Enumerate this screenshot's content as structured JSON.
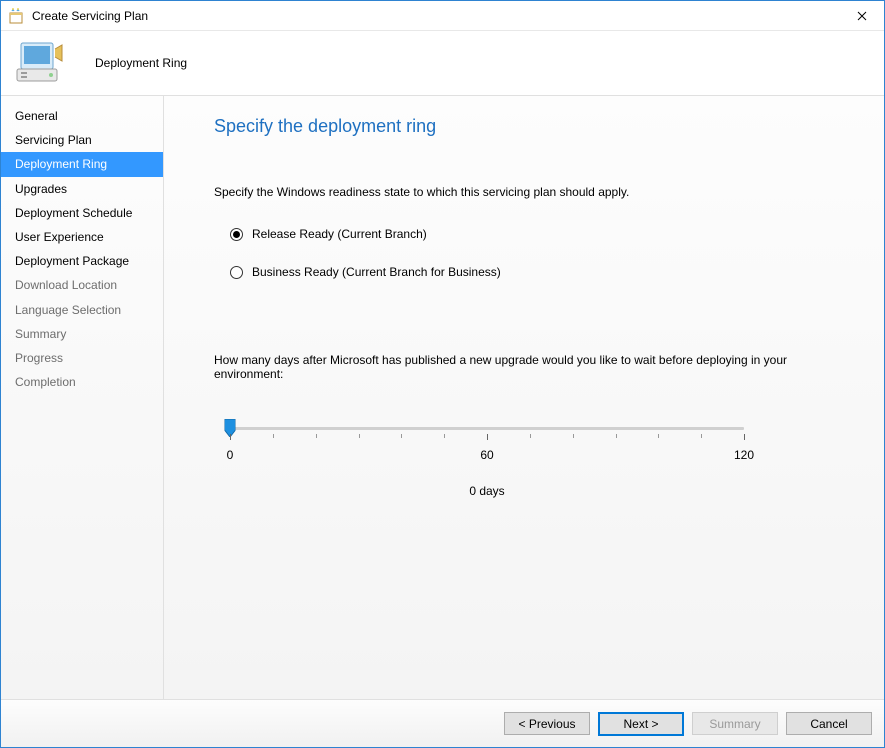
{
  "window": {
    "title": "Create Servicing Plan"
  },
  "header": {
    "subtitle": "Deployment Ring"
  },
  "sidebar": {
    "items": [
      {
        "label": "General",
        "state": "enabled"
      },
      {
        "label": "Servicing Plan",
        "state": "enabled"
      },
      {
        "label": "Deployment Ring",
        "state": "active"
      },
      {
        "label": "Upgrades",
        "state": "enabled"
      },
      {
        "label": "Deployment Schedule",
        "state": "enabled"
      },
      {
        "label": "User Experience",
        "state": "enabled"
      },
      {
        "label": "Deployment Package",
        "state": "enabled"
      },
      {
        "label": "Download Location",
        "state": "disabled"
      },
      {
        "label": "Language Selection",
        "state": "disabled"
      },
      {
        "label": "Summary",
        "state": "disabled"
      },
      {
        "label": "Progress",
        "state": "disabled"
      },
      {
        "label": "Completion",
        "state": "disabled"
      }
    ]
  },
  "main": {
    "title": "Specify the deployment ring",
    "instruction": "Specify the Windows readiness state to which this servicing plan should apply.",
    "radios": {
      "release": "Release Ready (Current Branch)",
      "business": "Business Ready (Current Branch for Business)",
      "selected": "release"
    },
    "slider": {
      "question": "How many days after Microsoft has published a new upgrade would you like to wait before deploying in your environment:",
      "min_label": "0",
      "mid_label": "60",
      "max_label": "120",
      "value_label": "0 days",
      "value": 0,
      "min": 0,
      "max": 120
    }
  },
  "footer": {
    "previous": "< Previous",
    "next": "Next >",
    "summary": "Summary",
    "cancel": "Cancel"
  }
}
